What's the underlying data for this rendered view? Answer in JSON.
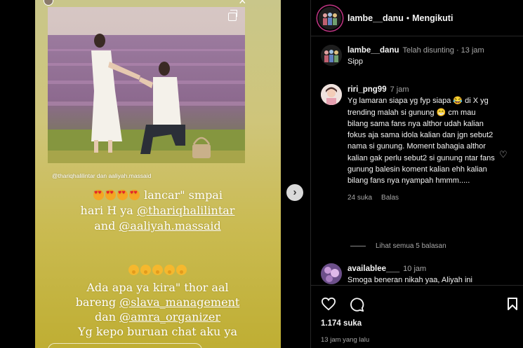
{
  "post": {
    "photo_tags": "@thariqhalilintar dan aaliyah.massaid",
    "caption_lines_1": [
      {
        "pre": "lancar\" smpai",
        "mention": ""
      },
      {
        "pre": "hari H ya ",
        "mention": "@thariqhalilintar"
      },
      {
        "pre": "and ",
        "mention": "@aaliyah.massaid"
      }
    ],
    "caption_lines_2": [
      {
        "pre": "Ada apa ya kira\" thor aal",
        "mention": ""
      },
      {
        "pre": "bareng ",
        "mention": "@slava_management"
      },
      {
        "pre": "dan ",
        "mention": "@amra_organizer"
      },
      {
        "pre": "Yg kepo buruan chat aku ya",
        "mention": ""
      }
    ],
    "next_label": "›",
    "close_label": "×"
  },
  "header": {
    "username": "lambe__danu",
    "separator": "•",
    "follow_label": "Mengikuti"
  },
  "comments": [
    {
      "username": "lambe__danu",
      "meta": "Telah disunting · 13 jam",
      "text": "Sipp"
    },
    {
      "username": "riri_png99",
      "meta": "7 jam",
      "text": "Yg lamaran siapa yg fyp siapa 😂 di X yg trending malah si gunung 😁 cm mau bilang sama fans nya althor udah kalian fokus aja sama idola kalian dan jgn sebut2 nama si gunung. Moment bahagia althor kalian gak perlu sebut2 si gunung ntar fans gunung balesin koment kalian ehh kalian bilang fans nya nyampah hmmm.....",
      "likes": "24 suka",
      "reply": "Balas",
      "view_replies": "Lihat semua 5 balasan"
    },
    {
      "username": "availablee___",
      "meta": "10 jam",
      "text": "Smoga beneran nikah yaa, Aliyah ini"
    }
  ],
  "footer": {
    "likes": "1.174 suka",
    "time": "13 jam yang lalu"
  }
}
